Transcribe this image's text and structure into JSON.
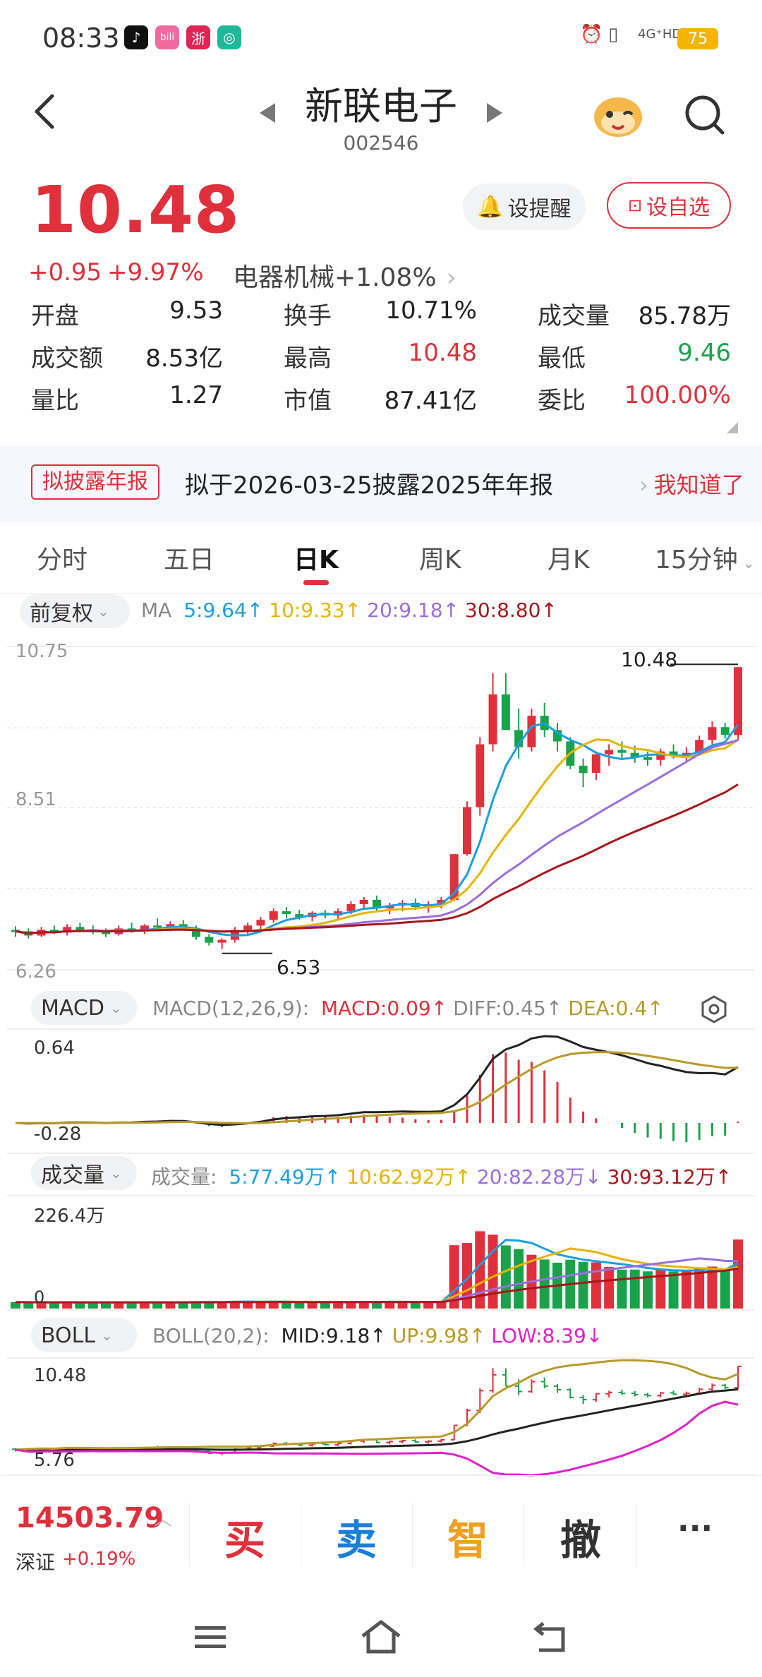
{
  "status": {
    "time": "08:33",
    "network": "4G⁺HD",
    "battery": "75",
    "icons": [
      "tiktok-icon",
      "bilibili-icon",
      "zhe-icon",
      "wechat-like-icon",
      "alarm-icon",
      "vibrate-icon",
      "signal-icon"
    ]
  },
  "header": {
    "stock_name": "新联电子",
    "stock_code": "002546",
    "back_icon": "back-arrow-icon",
    "mascot_icon": "mascot-icon",
    "search_icon": "search-icon"
  },
  "quote": {
    "price": "10.48",
    "change": "+0.95",
    "change_pct": "+9.97%",
    "sector": "电器机械",
    "sector_pct": "+1.08%",
    "alert_label": "设提醒",
    "watch_label": "设自选",
    "colors": {
      "up": "#e0303b",
      "down": "#1aa24a"
    }
  },
  "stats": [
    [
      {
        "label": "开盘",
        "value": "9.53",
        "color": "#222"
      },
      {
        "label": "换手",
        "value": "10.71%",
        "color": "#222"
      },
      {
        "label": "成交量",
        "value": "85.78万",
        "color": "#222"
      }
    ],
    [
      {
        "label": "成交额",
        "value": "8.53亿",
        "color": "#222"
      },
      {
        "label": "最高",
        "value": "10.48",
        "color": "#e0303b"
      },
      {
        "label": "最低",
        "value": "9.46",
        "color": "#1aa24a"
      }
    ],
    [
      {
        "label": "量比",
        "value": "1.27",
        "color": "#222"
      },
      {
        "label": "市值",
        "value": "87.41亿",
        "color": "#222"
      },
      {
        "label": "委比",
        "value": "100.00%",
        "color": "#e0303b"
      }
    ]
  ],
  "banner": {
    "tag": "拟披露年报",
    "text": "拟于2026-03-25披露2025年年报",
    "action": "我知道了"
  },
  "tabs": [
    {
      "label": "分时",
      "active": false
    },
    {
      "label": "五日",
      "active": false
    },
    {
      "label": "日K",
      "active": true
    },
    {
      "label": "周K",
      "active": false
    },
    {
      "label": "月K",
      "active": false
    },
    {
      "label": "15分钟",
      "active": false
    }
  ],
  "kchart": {
    "adjust": "前复权",
    "ma_label": "MA",
    "ma": [
      {
        "text": "5:9.64↑",
        "color": "#1a9fe0"
      },
      {
        "text": "10:9.33↑",
        "color": "#e6b400"
      },
      {
        "text": "20:9.18↑",
        "color": "#9a6ee0"
      },
      {
        "text": "30:8.80↑",
        "color": "#a8161c"
      }
    ],
    "y_top": "10.75",
    "y_mid": "8.51",
    "y_bottom": "6.26",
    "high_mark": "10.48",
    "low_mark": "6.53"
  },
  "macd": {
    "selector": "MACD",
    "params": "MACD(12,26,9):",
    "items": [
      {
        "text": "MACD:0.09↑",
        "color": "#e0303b"
      },
      {
        "text": "DIFF:0.45↑",
        "color": "#888888"
      },
      {
        "text": "DEA:0.4↑",
        "color": "#b89a28"
      }
    ],
    "y_top": "0.64",
    "y_bottom": "-0.28"
  },
  "volume": {
    "selector": "成交量",
    "label": "成交量:",
    "items": [
      {
        "text": "5:77.49万↑",
        "color": "#1a9fe0"
      },
      {
        "text": "10:62.92万↑",
        "color": "#e6b400"
      },
      {
        "text": "20:82.28万↓",
        "color": "#9a6ee0"
      },
      {
        "text": "30:93.12万↑",
        "color": "#a8161c"
      }
    ],
    "y_top": "226.4万",
    "y_bottom": "0"
  },
  "boll": {
    "selector": "BOLL",
    "params": "BOLL(20,2):",
    "items": [
      {
        "text": "MID:9.18↑",
        "color": "#222222"
      },
      {
        "text": "UP:9.98↑",
        "color": "#b89a28"
      },
      {
        "text": "LOW:8.39↓",
        "color": "#e020c8"
      }
    ],
    "y_top": "10.48",
    "y_bottom": "5.76"
  },
  "bottom": {
    "index_value": "14503.79",
    "index_name": "深证",
    "index_pct": "+0.19%",
    "buy": "买",
    "sell": "卖",
    "smart": "智",
    "cancel": "撤",
    "more": "···"
  },
  "chart_data": {
    "type": "candlestick",
    "series_ohlc": [
      [
        6.8,
        6.85,
        6.7,
        6.78
      ],
      [
        6.78,
        6.82,
        6.68,
        6.72
      ],
      [
        6.72,
        6.84,
        6.7,
        6.8
      ],
      [
        6.8,
        6.86,
        6.74,
        6.76
      ],
      [
        6.76,
        6.88,
        6.72,
        6.84
      ],
      [
        6.84,
        6.9,
        6.78,
        6.8
      ],
      [
        6.8,
        6.86,
        6.74,
        6.78
      ],
      [
        6.78,
        6.82,
        6.7,
        6.74
      ],
      [
        6.74,
        6.86,
        6.72,
        6.82
      ],
      [
        6.82,
        6.9,
        6.76,
        6.8
      ],
      [
        6.8,
        6.88,
        6.74,
        6.86
      ],
      [
        6.86,
        6.96,
        6.8,
        6.84
      ],
      [
        6.84,
        6.92,
        6.78,
        6.88
      ],
      [
        6.88,
        6.94,
        6.8,
        6.82
      ],
      [
        6.82,
        6.86,
        6.66,
        6.7
      ],
      [
        6.7,
        6.74,
        6.58,
        6.62
      ],
      [
        6.62,
        6.68,
        6.53,
        6.66
      ],
      [
        6.66,
        6.84,
        6.62,
        6.8
      ],
      [
        6.8,
        6.9,
        6.74,
        6.86
      ],
      [
        6.86,
        6.98,
        6.8,
        6.94
      ],
      [
        6.94,
        7.1,
        6.9,
        7.06
      ],
      [
        7.06,
        7.12,
        6.96,
        7.02
      ],
      [
        7.02,
        7.08,
        6.94,
        6.98
      ],
      [
        6.98,
        7.06,
        6.92,
        7.04
      ],
      [
        7.04,
        7.08,
        6.96,
        7.0
      ],
      [
        7.0,
        7.1,
        6.94,
        7.06
      ],
      [
        7.06,
        7.2,
        7.02,
        7.16
      ],
      [
        7.16,
        7.26,
        7.08,
        7.22
      ],
      [
        7.22,
        7.28,
        7.06,
        7.1
      ],
      [
        7.1,
        7.18,
        7.02,
        7.14
      ],
      [
        7.14,
        7.22,
        7.06,
        7.18
      ],
      [
        7.18,
        7.24,
        7.08,
        7.12
      ],
      [
        7.12,
        7.2,
        7.04,
        7.16
      ],
      [
        7.16,
        7.26,
        7.1,
        7.22
      ],
      [
        7.22,
        7.86,
        7.2,
        7.86
      ],
      [
        7.86,
        8.6,
        7.84,
        8.52
      ],
      [
        8.52,
        9.5,
        8.4,
        9.4
      ],
      [
        9.4,
        10.4,
        9.3,
        10.1
      ],
      [
        10.1,
        10.4,
        9.6,
        9.6
      ],
      [
        9.6,
        9.9,
        9.2,
        9.36
      ],
      [
        9.36,
        9.9,
        9.3,
        9.8
      ],
      [
        9.8,
        9.98,
        9.5,
        9.6
      ],
      [
        9.6,
        9.7,
        9.3,
        9.44
      ],
      [
        9.44,
        9.5,
        9.05,
        9.1
      ],
      [
        9.1,
        9.2,
        8.8,
        9.0
      ],
      [
        9.0,
        9.3,
        8.9,
        9.26
      ],
      [
        9.26,
        9.4,
        9.1,
        9.32
      ],
      [
        9.32,
        9.44,
        9.2,
        9.28
      ],
      [
        9.28,
        9.38,
        9.14,
        9.22
      ],
      [
        9.22,
        9.3,
        9.1,
        9.18
      ],
      [
        9.18,
        9.34,
        9.1,
        9.3
      ],
      [
        9.3,
        9.4,
        9.2,
        9.24
      ],
      [
        9.24,
        9.36,
        9.16,
        9.28
      ],
      [
        9.28,
        9.52,
        9.24,
        9.46
      ],
      [
        9.46,
        9.72,
        9.4,
        9.64
      ],
      [
        9.64,
        9.7,
        9.48,
        9.53
      ],
      [
        9.53,
        10.48,
        9.46,
        10.48
      ]
    ],
    "price_range": [
      6.26,
      10.75
    ]
  }
}
